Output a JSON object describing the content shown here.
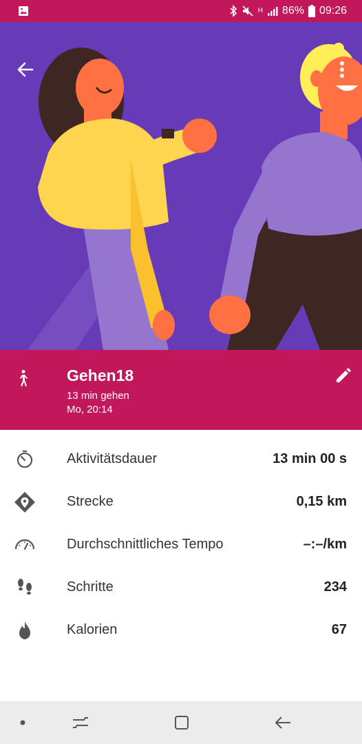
{
  "status_bar": {
    "battery": "86%",
    "time": "09:26",
    "network": "H"
  },
  "header": {
    "back_icon": "arrow-back-icon",
    "more_icon": "more-vert-icon"
  },
  "activity": {
    "title": "Gehen18",
    "subtitle": "13 min gehen",
    "datetime": "Mo, 20:14",
    "type_icon": "walking-icon",
    "edit_icon": "edit-pencil-icon"
  },
  "stats": [
    {
      "label": "Aktivitätsdauer",
      "value": "13 min 00 s",
      "icon": "timer-icon"
    },
    {
      "label": "Strecke",
      "value": "0,15 km",
      "icon": "location-diamond-icon"
    },
    {
      "label": "Durchschnittliches Tempo",
      "value": "–:–/km",
      "icon": "speedometer-icon"
    },
    {
      "label": "Schritte",
      "value": "234",
      "icon": "footsteps-icon"
    },
    {
      "label": "Kalorien",
      "value": "67",
      "icon": "flame-icon"
    }
  ],
  "colors": {
    "accent": "#c2185b",
    "hero_bg": "#673ab7"
  }
}
